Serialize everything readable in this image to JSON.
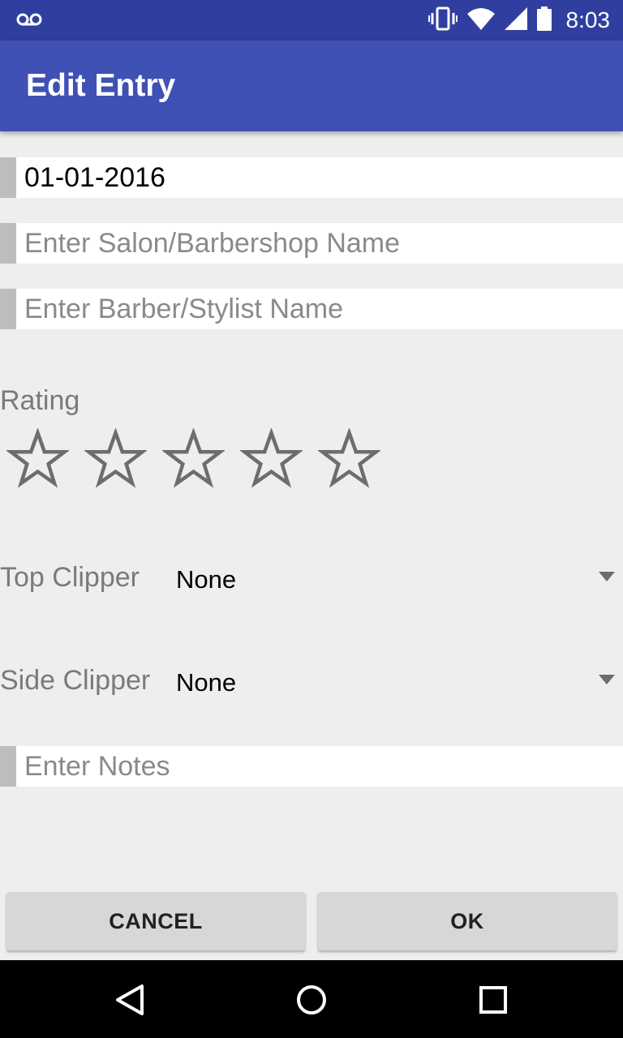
{
  "status_bar": {
    "time": "8:03",
    "icons": [
      "voicemail-icon",
      "vibrate-icon",
      "wifi-icon",
      "signal-icon",
      "battery-icon"
    ]
  },
  "app_bar": {
    "title": "Edit Entry"
  },
  "form": {
    "date": {
      "value": "01-01-2016",
      "placeholder": ""
    },
    "salon": {
      "value": "",
      "placeholder": "Enter Salon/Barbershop Name"
    },
    "barber": {
      "value": "",
      "placeholder": "Enter Barber/Stylist Name"
    },
    "rating": {
      "label": "Rating",
      "value": 0,
      "max": 5
    },
    "top_clipper": {
      "label": "Top Clipper",
      "selected": "None"
    },
    "side_clipper": {
      "label": "Side Clipper",
      "selected": "None"
    },
    "notes": {
      "value": "",
      "placeholder": "Enter Notes"
    }
  },
  "buttons": {
    "cancel": "CANCEL",
    "ok": "OK"
  },
  "nav_bar": {
    "icons": [
      "back-icon",
      "home-icon",
      "recents-icon"
    ]
  },
  "colors": {
    "primary": "#3f51b5",
    "primary_dark": "#303f9f",
    "background": "#eeeeee"
  }
}
